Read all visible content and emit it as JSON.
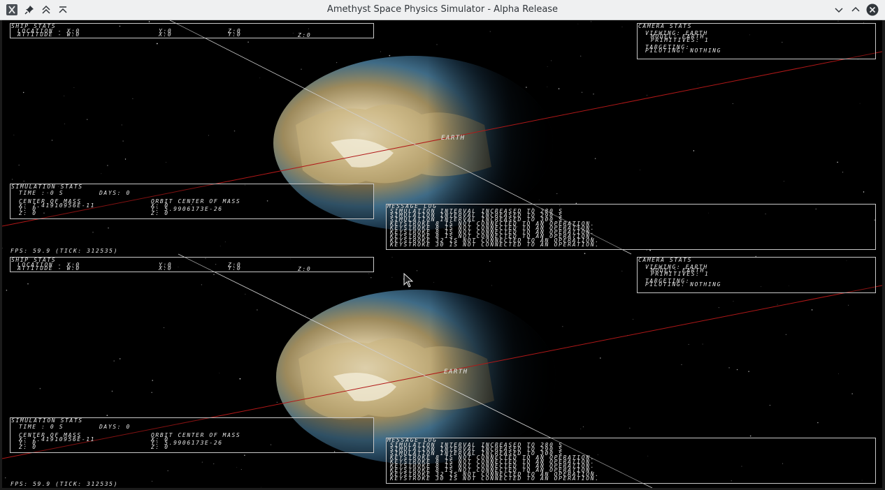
{
  "window": {
    "title": "Amethyst Space Physics Simulator - Alpha Release"
  },
  "views": [
    {
      "ship": {
        "heading": "Ship stats",
        "location_label": "Location - X:0",
        "location_y": "Y:0",
        "location_z": "Z:0",
        "attitude_label": "Attitude - W:0",
        "attitude_x": "X:0",
        "attitude_y": "Y:0",
        "attitude_z": "Z:0"
      },
      "camera": {
        "heading": "Camera stats",
        "viewing": "Viewing: Earth",
        "model": "Model: Earth",
        "primitives": "Primitives: 1",
        "targeting": "Targeting:",
        "piloting": "Piloting: Nothing"
      },
      "earth_label": "Earth",
      "simulation": {
        "heading": "Simulation stats",
        "time": "Time : 0 s",
        "days": "Days: 0",
        "com_header": "Center of mass",
        "orbit_header": "Orbit center of mass",
        "com_x": "X: 7.41910956E-11",
        "com_y": "Y: 0",
        "com_z": "Z: 0",
        "orbit_x": "X: 0",
        "orbit_y": "Y: 5.9906173E-26",
        "orbit_z": "Z: 0"
      },
      "fps": "FPS: 59.9 (Tick: 312535)",
      "message_log": {
        "heading": "Message log",
        "lines": [
          "Simulation interval increased to 280 s",
          "Simulation interval increased to 290 s",
          "Simulation interval increased to 300 s",
          "Keystroke 8 is not connected to an operation.",
          "Keystroke 8 is not connected to an operation.",
          "Keystroke 8 is not connected to an operation.",
          "Keystroke 8 is not connected to an operation.",
          "Keystroke 32 is not connected to an operation.",
          "Keystroke 30 is not connected to an operation."
        ]
      }
    },
    {
      "ship": {
        "heading": "Ship stats",
        "location_label": "Location - X:0",
        "location_y": "Y:0",
        "location_z": "Z:0",
        "attitude_label": "Attitude - W:0",
        "attitude_x": "X:0",
        "attitude_y": "Y:0",
        "attitude_z": "Z:0"
      },
      "camera": {
        "heading": "Camera stats",
        "viewing": "Viewing: Earth",
        "model": "Model: Earth",
        "primitives": "Primitives: 1",
        "targeting": "Targeting:",
        "piloting": "Piloting: Nothing"
      },
      "earth_label": "Earth",
      "simulation": {
        "heading": "Simulation stats",
        "time": "Time : 0 s",
        "days": "Days: 0",
        "com_header": "Center of mass",
        "orbit_header": "Orbit center of mass",
        "com_x": "X: 7.41910956E-11",
        "com_y": "Y: 0",
        "com_z": "Z: 0",
        "orbit_x": "X: 0",
        "orbit_y": "Y: 5.9906173E-26",
        "orbit_z": "Z: 0"
      },
      "fps": "FPS: 59.9 (Tick: 312535)",
      "message_log": {
        "heading": "Message log",
        "lines": [
          "Simulation interval increased to 280 s",
          "Simulation interval increased to 290 s",
          "Simulation interval increased to 300 s",
          "Keystroke 8 is not connected to an operation.",
          "Keystroke 8 is not connected to an operation.",
          "Keystroke 8 is not connected to an operation.",
          "Keystroke 8 is not connected to an operation.",
          "Keystroke 32 is not connected to an operation.",
          "Keystroke 30 is not connected to an operation."
        ]
      }
    }
  ],
  "icons": {
    "app": "app-icon",
    "pin": "pin-icon",
    "keep_above": "keep-above-icon",
    "shade": "shade-icon",
    "minimize": "minimize-icon",
    "maximize": "maximize-icon",
    "close": "close-icon",
    "cursor": "mouse-cursor-icon"
  },
  "colors": {
    "titlebar": "#eff0f1",
    "hud_text": "#e6e6e6",
    "orbit_line_red": "#b01818",
    "axis_line_white": "#d0d0d0",
    "space": "#000000"
  }
}
